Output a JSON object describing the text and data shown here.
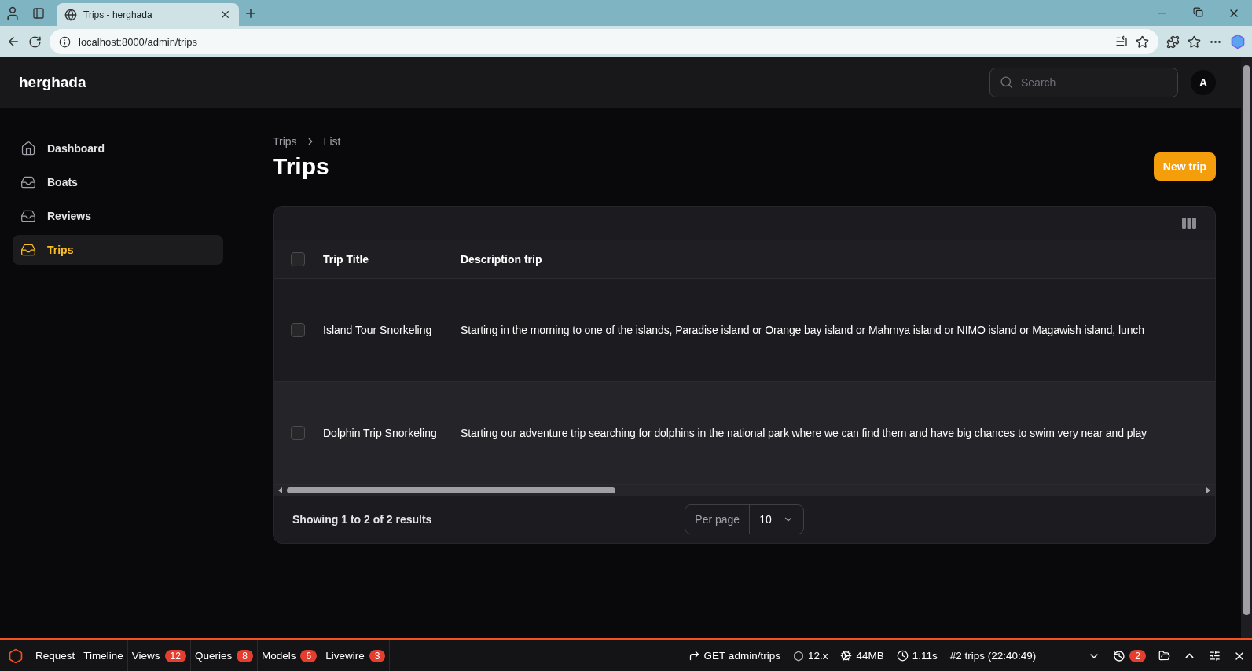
{
  "browser": {
    "tab_title": "Trips - herghada",
    "url": "localhost:8000/admin/trips"
  },
  "header": {
    "brand": "herghada",
    "search": {
      "placeholder": "Search"
    },
    "avatar": "A"
  },
  "sidebar": {
    "items": [
      {
        "label": "Dashboard",
        "kind": "home",
        "selected": false
      },
      {
        "label": "Boats",
        "kind": "stack",
        "selected": false
      },
      {
        "label": "Reviews",
        "kind": "stack",
        "selected": false
      },
      {
        "label": "Trips",
        "kind": "stack",
        "selected": true
      }
    ]
  },
  "breadcrumbs": [
    "Trips",
    "List"
  ],
  "title": "Trips",
  "new_button": "New trip",
  "table": {
    "columns": [
      "Trip Title",
      "Description trip"
    ],
    "header_checked": false,
    "rows": [
      {
        "checked": false,
        "title": "Island Tour Snorkeling",
        "description": "Starting in the morning to one of the islands, Paradise island or Orange bay island or Mahmya island or NIMO island or Magawish island, lunch"
      },
      {
        "checked": false,
        "title": "Dolphin Trip Snorkeling",
        "description": "Starting our adventure trip searching for dolphins in the national park where we can find them and have big chances to swim very near and play"
      }
    ],
    "footer": "Showing 1 to 2 of 2 results",
    "per_page_label": "Per page",
    "per_page": "10"
  },
  "debugbar": {
    "tabs": [
      {
        "label": "Request"
      },
      {
        "label": "Timeline"
      },
      {
        "label": "Views",
        "count": "12"
      },
      {
        "label": "Queries",
        "count": "8"
      },
      {
        "label": "Models",
        "count": "6"
      },
      {
        "label": "Livewire",
        "count": "3"
      }
    ],
    "route": "GET admin/trips",
    "version": "12.x",
    "memory": "44MB",
    "duration": "1.11s",
    "request": "#2 trips (22:40:49)",
    "history_count": "2"
  }
}
